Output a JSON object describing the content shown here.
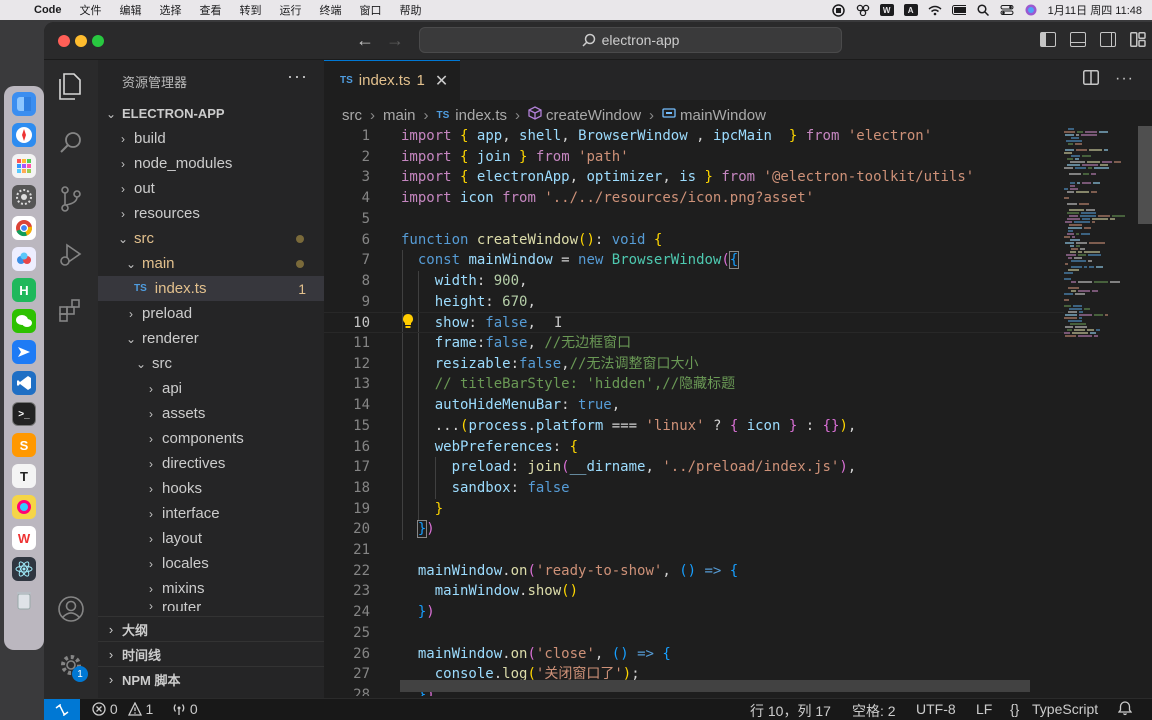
{
  "menubar": {
    "app_name": "Code",
    "items": [
      "文件",
      "编辑",
      "选择",
      "查看",
      "转到",
      "运行",
      "终端",
      "窗口",
      "帮助"
    ],
    "clock": "1月11日 周四  11:48"
  },
  "window": {
    "command_center": "electron-app"
  },
  "activity": {
    "manage_badge": "1"
  },
  "sidebar": {
    "title": "资源管理器",
    "more": "···",
    "project": "ELECTRON-APP",
    "tree": [
      {
        "label": "build"
      },
      {
        "label": "node_modules"
      },
      {
        "label": "out"
      },
      {
        "label": "resources"
      },
      {
        "label": "src"
      },
      {
        "label": "main"
      },
      {
        "label": "index.ts",
        "errors": "1"
      },
      {
        "label": "preload"
      },
      {
        "label": "renderer"
      },
      {
        "label": "src"
      },
      {
        "label": "api"
      },
      {
        "label": "assets"
      },
      {
        "label": "components"
      },
      {
        "label": "directives"
      },
      {
        "label": "hooks"
      },
      {
        "label": "interface"
      },
      {
        "label": "layout"
      },
      {
        "label": "locales"
      },
      {
        "label": "mixins"
      },
      {
        "label": "router"
      }
    ],
    "sections": [
      "大纲",
      "时间线",
      "NPM 脚本"
    ]
  },
  "editor": {
    "tab": {
      "badge": "TS",
      "name": "index.ts",
      "count": "1"
    },
    "breadcrumb": [
      "src",
      "main",
      "index.ts",
      "createWindow",
      "mainWindow"
    ],
    "current_line": 10,
    "line_numbers": [
      "1",
      "2",
      "3",
      "4",
      "5",
      "6",
      "7",
      "8",
      "9",
      "10",
      "11",
      "12",
      "13",
      "14",
      "15",
      "16",
      "17",
      "18",
      "19",
      "20",
      "21",
      "22",
      "23",
      "24",
      "25",
      "26",
      "27",
      "28"
    ]
  },
  "statusbar": {
    "errors": "0",
    "warnings": "1",
    "ports": "0",
    "position": "行 10，列 17",
    "spaces": "空格: 2",
    "encoding": "UTF-8",
    "eol": "LF",
    "braces": "{}",
    "language": "TypeScript"
  },
  "colors": {
    "accent": "#0078d4",
    "modified": "#e2c08d",
    "ts_badge": "#4f9de0"
  }
}
